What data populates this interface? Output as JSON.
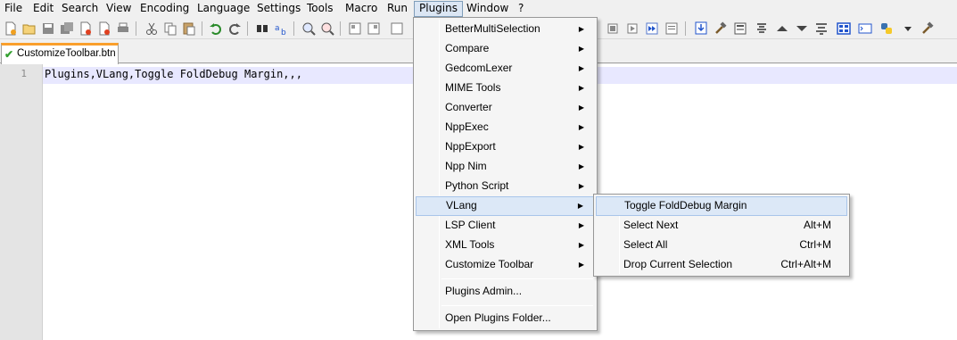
{
  "menubar": {
    "items": [
      "File",
      "Edit",
      "Search",
      "View",
      "Encoding",
      "Language",
      "Settings",
      "Tools",
      "Macro",
      "Run",
      "Plugins",
      "Window",
      "?"
    ],
    "active": "Plugins"
  },
  "tab": {
    "label": "CustomizeToolbar.btn"
  },
  "editor": {
    "line_number": "1",
    "line_text": "Plugins,VLang,Toggle FoldDebug Margin,,,"
  },
  "plugins_menu": {
    "items": [
      {
        "label": "BetterMultiSelection",
        "has_submenu": true
      },
      {
        "label": "Compare",
        "has_submenu": true
      },
      {
        "label": "GedcomLexer",
        "has_submenu": true
      },
      {
        "label": "MIME Tools",
        "has_submenu": true
      },
      {
        "label": "Converter",
        "has_submenu": true
      },
      {
        "label": "NppExec",
        "has_submenu": true
      },
      {
        "label": "NppExport",
        "has_submenu": true
      },
      {
        "label": "Npp Nim",
        "has_submenu": true
      },
      {
        "label": "Python Script",
        "has_submenu": true
      },
      {
        "label": "VLang",
        "has_submenu": true
      },
      {
        "label": "LSP Client",
        "has_submenu": true
      },
      {
        "label": "XML Tools",
        "has_submenu": true
      },
      {
        "label": "Customize Toolbar",
        "has_submenu": true
      }
    ],
    "admin": "Plugins Admin...",
    "open_folder": "Open Plugins Folder...",
    "highlighted": "VLang"
  },
  "vlang_submenu": {
    "items": [
      {
        "label": "Toggle FoldDebug Margin",
        "shortcut": ""
      },
      {
        "label": "Select Next",
        "shortcut": "Alt+M"
      },
      {
        "label": "Select All",
        "shortcut": "Ctrl+M"
      },
      {
        "label": "Drop Current Selection",
        "shortcut": "Ctrl+Alt+M"
      }
    ],
    "highlighted": "Toggle FoldDebug Margin"
  },
  "colors": {
    "tab_accent": "#fa9f2c",
    "menu_highlight": "#dce8f7",
    "current_line": "#e8e8ff"
  },
  "icons": {
    "arrow": "▶",
    "check": "✔"
  }
}
